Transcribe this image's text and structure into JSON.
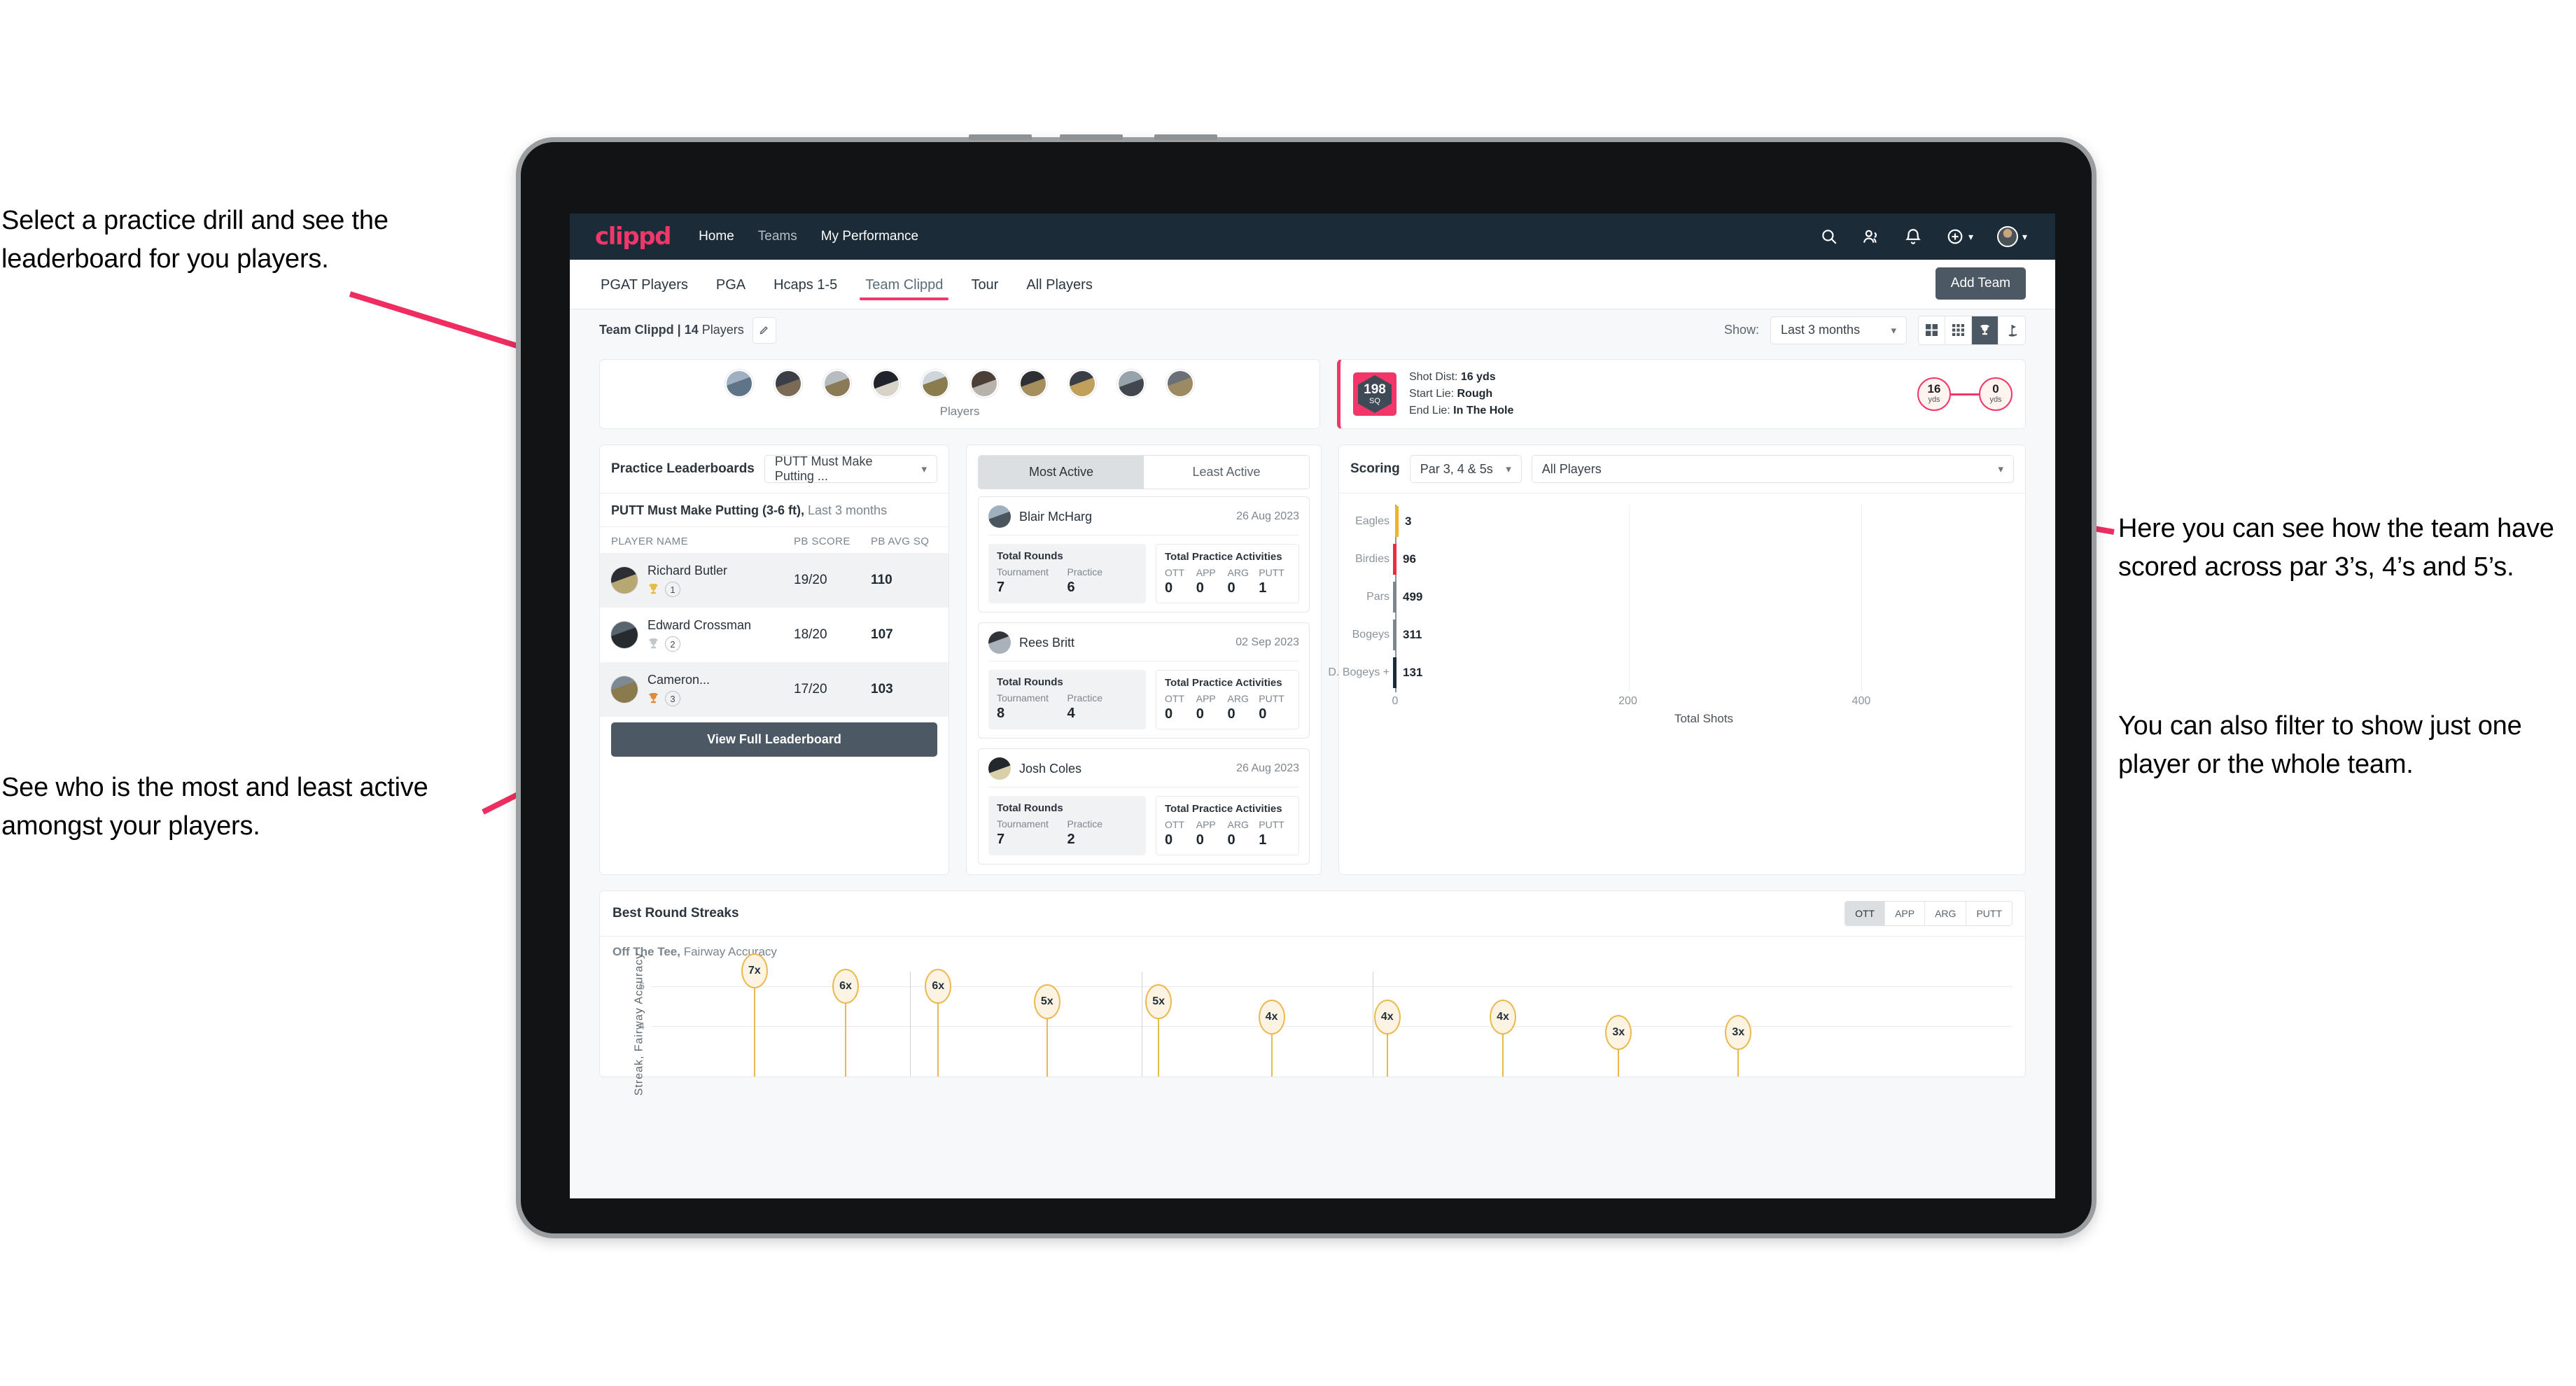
{
  "annotations": {
    "top_left": "Select a practice drill and see the leaderboard for you players.",
    "bottom_left": "See who is the most and least active amongst your players.",
    "right_1": "Here you can see how the team have scored across par 3’s, 4’s and 5’s.",
    "right_2": "You can also filter to show just one player or the whole team."
  },
  "app": {
    "logo": "clippd",
    "nav": [
      {
        "label": "Home",
        "active": true
      },
      {
        "label": "Teams",
        "active": false
      },
      {
        "label": "My Performance",
        "active": true
      }
    ],
    "icons": {
      "search": "search-icon",
      "people": "people-icon",
      "bell": "notification-bell-icon",
      "plus": "add-circle-icon",
      "avatar": "user-avatar"
    },
    "tabs": [
      {
        "label": "PGAT Players",
        "active": false
      },
      {
        "label": "PGA",
        "active": false
      },
      {
        "label": "Hcaps 1-5",
        "active": false
      },
      {
        "label": "Team Clippd",
        "active": true
      },
      {
        "label": "Tour",
        "active": false
      },
      {
        "label": "All Players",
        "active": false
      }
    ],
    "add_team_button": "Add Team",
    "toolbar": {
      "team_label_bold": "Team Clippd | 14",
      "team_label_rest": " Players",
      "edit_icon": "pencil-icon",
      "show_label": "Show:",
      "show_value": "Last 3 months",
      "view_buttons": [
        {
          "name": "grid-large-view",
          "active": false
        },
        {
          "name": "grid-small-view",
          "active": false
        },
        {
          "name": "trophy-view",
          "active": true
        },
        {
          "name": "flag-view",
          "active": false
        }
      ]
    }
  },
  "players_strip": {
    "label": "Players",
    "avatar_count": 10
  },
  "shot_card": {
    "sq_value": "198",
    "sq_unit": "SQ",
    "lines": [
      {
        "label": "Shot Dist:",
        "value": "16 yds"
      },
      {
        "label": "Start Lie:",
        "value": "Rough"
      },
      {
        "label": "End Lie:",
        "value": "In The Hole"
      }
    ],
    "start_dist": "16",
    "start_unit": "yds",
    "end_dist": "0",
    "end_unit": "yds"
  },
  "practice_leaderboards": {
    "title": "Practice Leaderboards",
    "drill_select": "PUTT Must Make Putting ...",
    "subtitle_bold": "PUTT Must Make Putting (3-6 ft),",
    "subtitle_rest": " Last 3 months",
    "columns": [
      "PLAYER NAME",
      "PB SCORE",
      "PB AVG SQ"
    ],
    "rows": [
      {
        "name": "Richard Butler",
        "rank": "1",
        "trophy": "gold",
        "score": "19/20",
        "avg": "110"
      },
      {
        "name": "Edward Crossman",
        "rank": "2",
        "trophy": "silver",
        "score": "18/20",
        "avg": "107"
      },
      {
        "name": "Cameron...",
        "rank": "3",
        "trophy": "bronze",
        "score": "17/20",
        "avg": "103"
      }
    ],
    "view_full_button": "View Full Leaderboard"
  },
  "activity": {
    "toggle": [
      {
        "label": "Most Active",
        "active": true
      },
      {
        "label": "Least Active",
        "active": false
      }
    ],
    "rounds_label": "Total Rounds",
    "practice_label": "Total Practice Activities",
    "rounds_cols": [
      "Tournament",
      "Practice"
    ],
    "practice_cols": [
      "OTT",
      "APP",
      "ARG",
      "PUTT"
    ],
    "cards": [
      {
        "name": "Blair McHarg",
        "date": "26 Aug 2023",
        "rounds": [
          "7",
          "6"
        ],
        "practice": [
          "0",
          "0",
          "0",
          "1"
        ]
      },
      {
        "name": "Rees Britt",
        "date": "02 Sep 2023",
        "rounds": [
          "8",
          "4"
        ],
        "practice": [
          "0",
          "0",
          "0",
          "0"
        ]
      },
      {
        "name": "Josh Coles",
        "date": "26 Aug 2023",
        "rounds": [
          "7",
          "2"
        ],
        "practice": [
          "0",
          "0",
          "0",
          "1"
        ]
      }
    ]
  },
  "scoring": {
    "title": "Scoring",
    "par_select": "Par 3, 4 & 5s",
    "player_select": "All Players"
  },
  "chart_data": [
    {
      "type": "bar",
      "orientation": "horizontal",
      "title": "Scoring",
      "categories": [
        "Eagles",
        "Birdies",
        "Pars",
        "Bogeys",
        "D. Bogeys +"
      ],
      "values": [
        3,
        96,
        499,
        311,
        131
      ],
      "cap_colors": [
        "#f0b429",
        "#ee2b45",
        "#7d878f",
        "#7d878f",
        "#1c2b38"
      ],
      "xlabel": "Total Shots",
      "ylabel": "",
      "xlim": [
        0,
        530
      ],
      "xticks": [
        0,
        200,
        400
      ],
      "grid": true,
      "legend": "none"
    },
    {
      "type": "scatter",
      "variant": "lollipop",
      "title": "Best Round Streaks",
      "subtitle_bold": "Off The Tee,",
      "subtitle_rest": " Fairway Accuracy",
      "ylabel": "Streak, Fairway Accuracy",
      "yticks": [
        4,
        6
      ],
      "ylim": [
        0,
        7.6
      ],
      "values": [
        7,
        6,
        6,
        5,
        5,
        4,
        4,
        4,
        3,
        3
      ],
      "labels": [
        "7x",
        "6x",
        "6x",
        "5x",
        "5x",
        "4x",
        "4x",
        "4x",
        "3x",
        "3x"
      ],
      "color": "#eab94e"
    }
  ],
  "streaks": {
    "title": "Best Round Streaks",
    "segments": [
      {
        "label": "OTT",
        "active": true
      },
      {
        "label": "APP",
        "active": false
      },
      {
        "label": "ARG",
        "active": false
      },
      {
        "label": "PUTT",
        "active": false
      }
    ]
  }
}
